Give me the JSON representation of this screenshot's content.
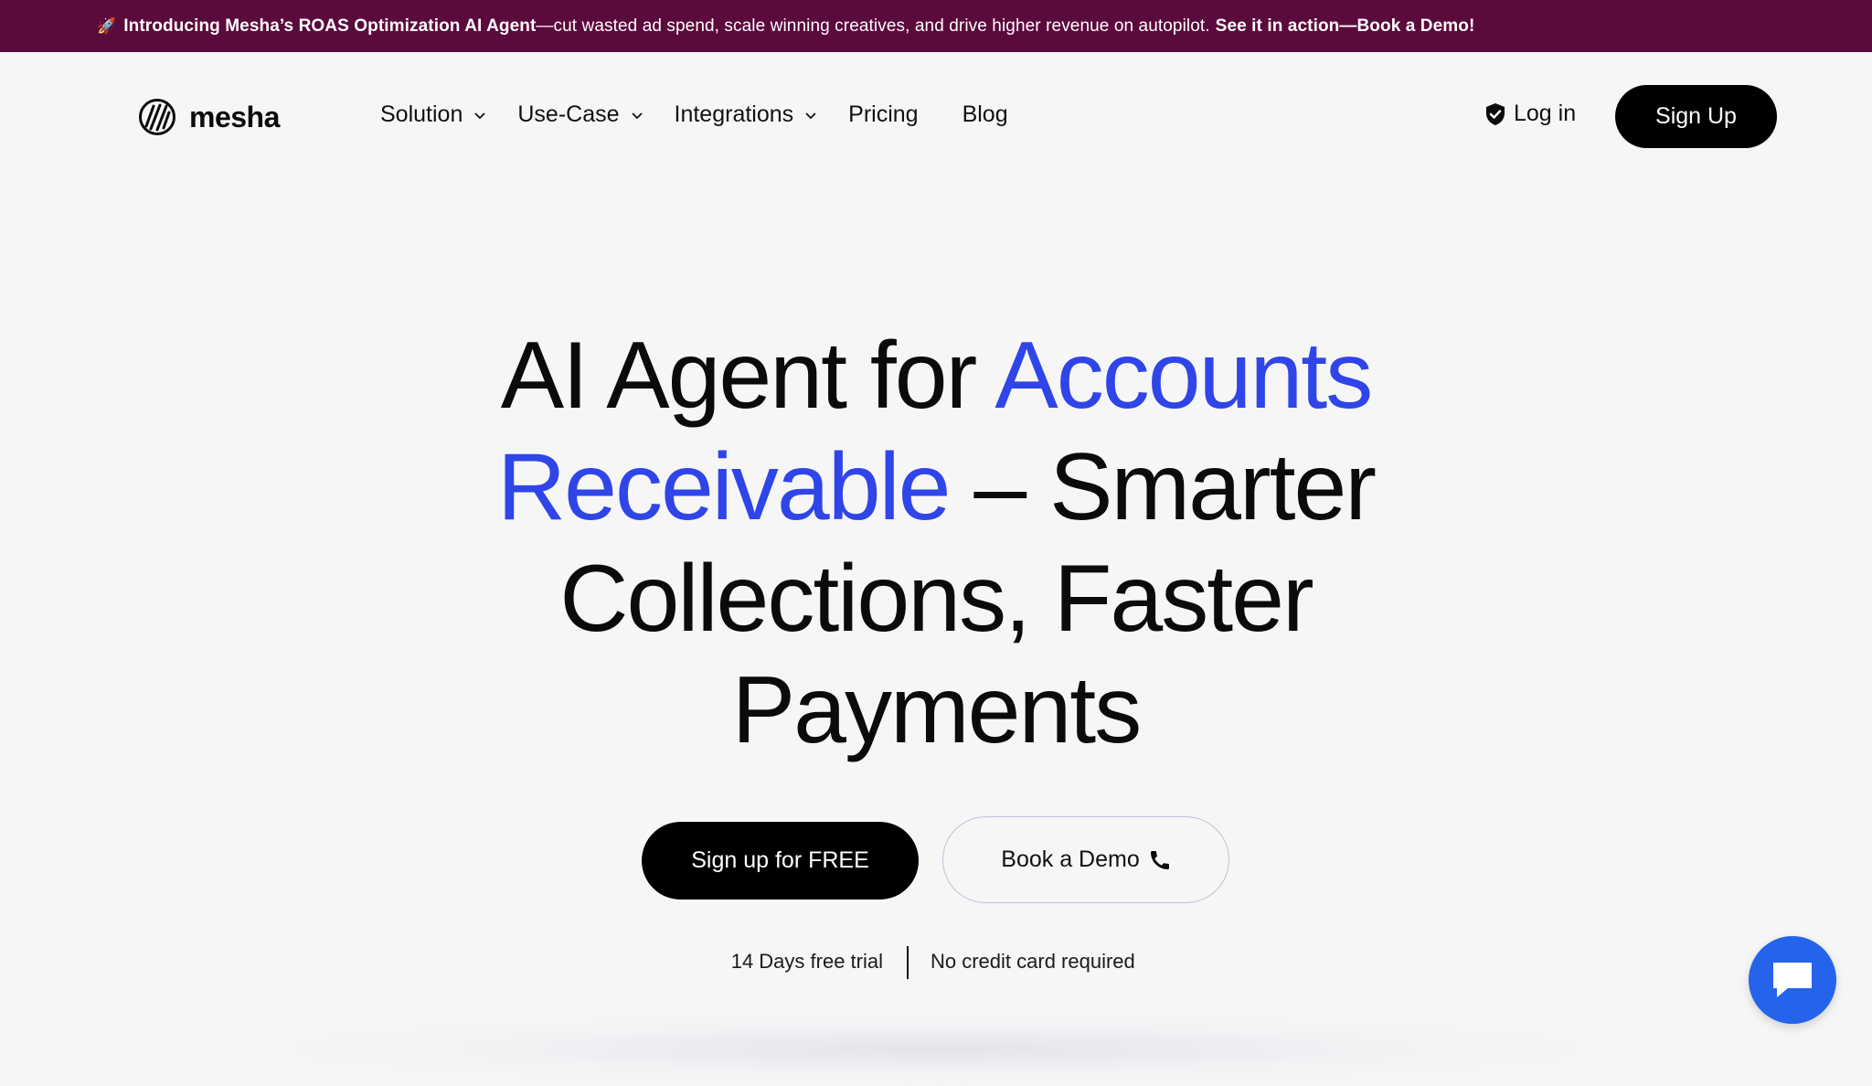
{
  "announcement": {
    "rocket": "🚀",
    "intro_bold": "Introducing Mesha’s ROAS Optimization AI Agent",
    "body": "—cut wasted ad spend, scale winning creatives, and drive higher revenue on autopilot.",
    "cta": "See it in action—Book a Demo!"
  },
  "brand": {
    "name": "mesha"
  },
  "nav": {
    "items": [
      {
        "label": "Solution",
        "dropdown": true
      },
      {
        "label": "Use-Case",
        "dropdown": true
      },
      {
        "label": "Integrations",
        "dropdown": true
      },
      {
        "label": "Pricing",
        "dropdown": false
      },
      {
        "label": "Blog",
        "dropdown": false
      }
    ],
    "login": "Log in",
    "signup": "Sign Up"
  },
  "hero": {
    "line1_plain": "AI Agent for ",
    "line1_highlight": "Accounts",
    "line2_highlight": "Receivable",
    "line2_plain": " – Smarter",
    "line3": "Collections, Faster",
    "line4": "Payments"
  },
  "cta": {
    "primary": "Sign up for FREE",
    "secondary": "Book a Demo"
  },
  "trial": {
    "left": "14 Days free trial",
    "right": "No credit card required"
  },
  "colors": {
    "banner": "#5b0a3c",
    "accent_blue": "#2f45e8",
    "chat_blue": "#2563eb",
    "background": "#f6f6f7"
  },
  "icons": {
    "logo": "mesha-logo-icon",
    "chevron": "chevron-down-icon",
    "login": "shield-check-icon",
    "demo": "phone-icon",
    "chat": "chat-bubble-icon"
  }
}
